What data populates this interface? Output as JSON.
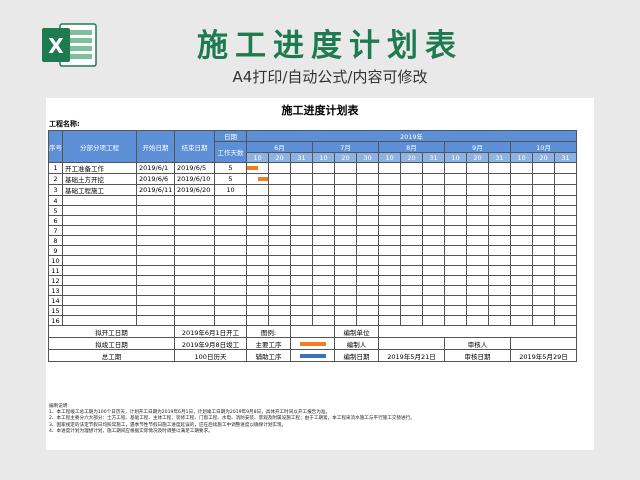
{
  "header": {
    "logo_letter": "X",
    "title": "施工进度计划表",
    "subtitle": "A4打印/自动公式/内容可修改"
  },
  "sheet": {
    "title": "施工进度计划表",
    "project_label": "工程名称:",
    "head": {
      "seq": "序号",
      "item": "分部分项工程",
      "start": "开始日期",
      "end": "结束日期",
      "date": "日期",
      "duration": "工作天数",
      "year": "2019年",
      "months": [
        "6月",
        "7月",
        "8月",
        "9月",
        "10月"
      ],
      "days": [
        "10",
        "20",
        "31",
        "10",
        "20",
        "30",
        "10",
        "20",
        "31",
        "10",
        "20",
        "31",
        "10",
        "20",
        "31"
      ]
    },
    "rows": [
      {
        "no": "1",
        "name": "开工准备工作",
        "start": "2019/6/1",
        "end": "2019/6/5",
        "days": "5"
      },
      {
        "no": "2",
        "name": "基础土方开挖",
        "start": "2019/6/6",
        "end": "2019/6/10",
        "days": "5"
      },
      {
        "no": "3",
        "name": "基础工程施工",
        "start": "2019/6/11",
        "end": "2019/6/20",
        "days": "10"
      },
      {
        "no": "4"
      },
      {
        "no": "5"
      },
      {
        "no": "6"
      },
      {
        "no": "7"
      },
      {
        "no": "8"
      },
      {
        "no": "9"
      },
      {
        "no": "10"
      },
      {
        "no": "11"
      },
      {
        "no": "12"
      },
      {
        "no": "13"
      },
      {
        "no": "14"
      },
      {
        "no": "15"
      },
      {
        "no": "16"
      }
    ],
    "footer": {
      "plan_start_label": "拟开工日期",
      "plan_start_value": "2019年6月1日开工",
      "legend_label": "图例:",
      "compiler_unit_label": "编制单位",
      "plan_finish_label": "拟竣工日期",
      "plan_finish_value": "2019年9月8日竣工",
      "main_process_label": "主要工序",
      "compiler_label": "编制人",
      "reviewer_label": "审核人",
      "total_label": "总工期",
      "total_value": "100日历天",
      "aux_process_label": "辅助工序",
      "compile_date_label": "编制日期",
      "compile_date_value": "2019年5月21日",
      "review_date_label": "审核日期",
      "review_date_value": "2019年5月29日"
    },
    "notes": [
      "编制说明:",
      "1、本工程竣工总工期为100个日历天，计划开工日期为2019年6月1日，计划竣工日期为2019年9月8日，具体开工时间以开工报告为准。",
      "2、本工程主要分六大部分：土方工程、基础工程、主体工程、装修工程、门窗工程、水电、消防安装、景观及附属设施工程；由于工期紧，本工程采流水施工与平行施工交替进行。",
      "3、国家规定的法定节假日均照常施工，遇季节性节假日施工进度延误的，应在后续施工中调整进度以确保计划实现。",
      "4、本进度计划为理想计划，施工期间应根据实际情况及时调整以满足工期要求。"
    ],
    "colors": {
      "main_process": "#f07f22",
      "aux_process": "#3a6fc4",
      "header_fill": "#5d8fd6"
    }
  }
}
